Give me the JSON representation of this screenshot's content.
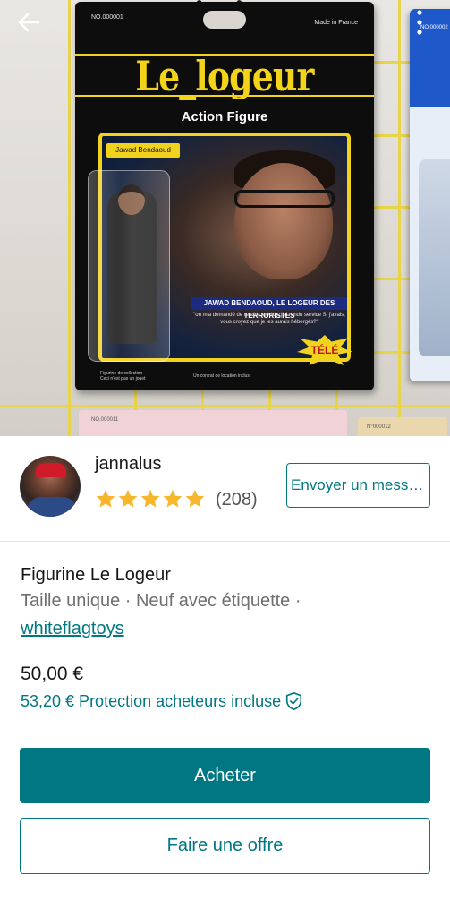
{
  "photo": {
    "card": {
      "number": "NO.000001",
      "made_in": "Made in France",
      "brand": "Le_logeur",
      "subtitle": "Action Figure",
      "name_tag": "Jawad Bendaoud",
      "banner": "JAWAD BENDAOUD, LE LOGEUR DES TERRORISTES",
      "quote": "\"on m'a demandé de rendre service, j'ai rendu service Si j'avais, vous croyez que je les aurais hébergés?\"",
      "badge": "TÉLÉ",
      "fine_left": "Figurine de collection\nCeci n'est pas un jouet",
      "fine_right": "Un contrat de location inclus"
    },
    "card2_number": "NO.000002",
    "card3_number": "NO.000011",
    "card4_number": "N°000012"
  },
  "seller": {
    "username": "jannalus",
    "rating": 5,
    "reviews": "(208)",
    "message_button": "Envoyer un message"
  },
  "item": {
    "title": "Figurine Le Logeur",
    "meta": "Taille unique · Neuf avec étiquette ·",
    "brand": "whiteflagtoys",
    "price": "50,00 €",
    "protection": "53,20 € Protection acheteurs incluse"
  },
  "actions": {
    "buy": "Acheter",
    "offer": "Faire une offre"
  },
  "colors": {
    "accent": "#007782",
    "star": "#F7B72D",
    "card_yellow": "#F1D21D"
  },
  "icons": {
    "back": "arrow-left-icon",
    "more": "more-vertical-icon",
    "shield": "shield-check-icon",
    "star": "star-icon"
  }
}
